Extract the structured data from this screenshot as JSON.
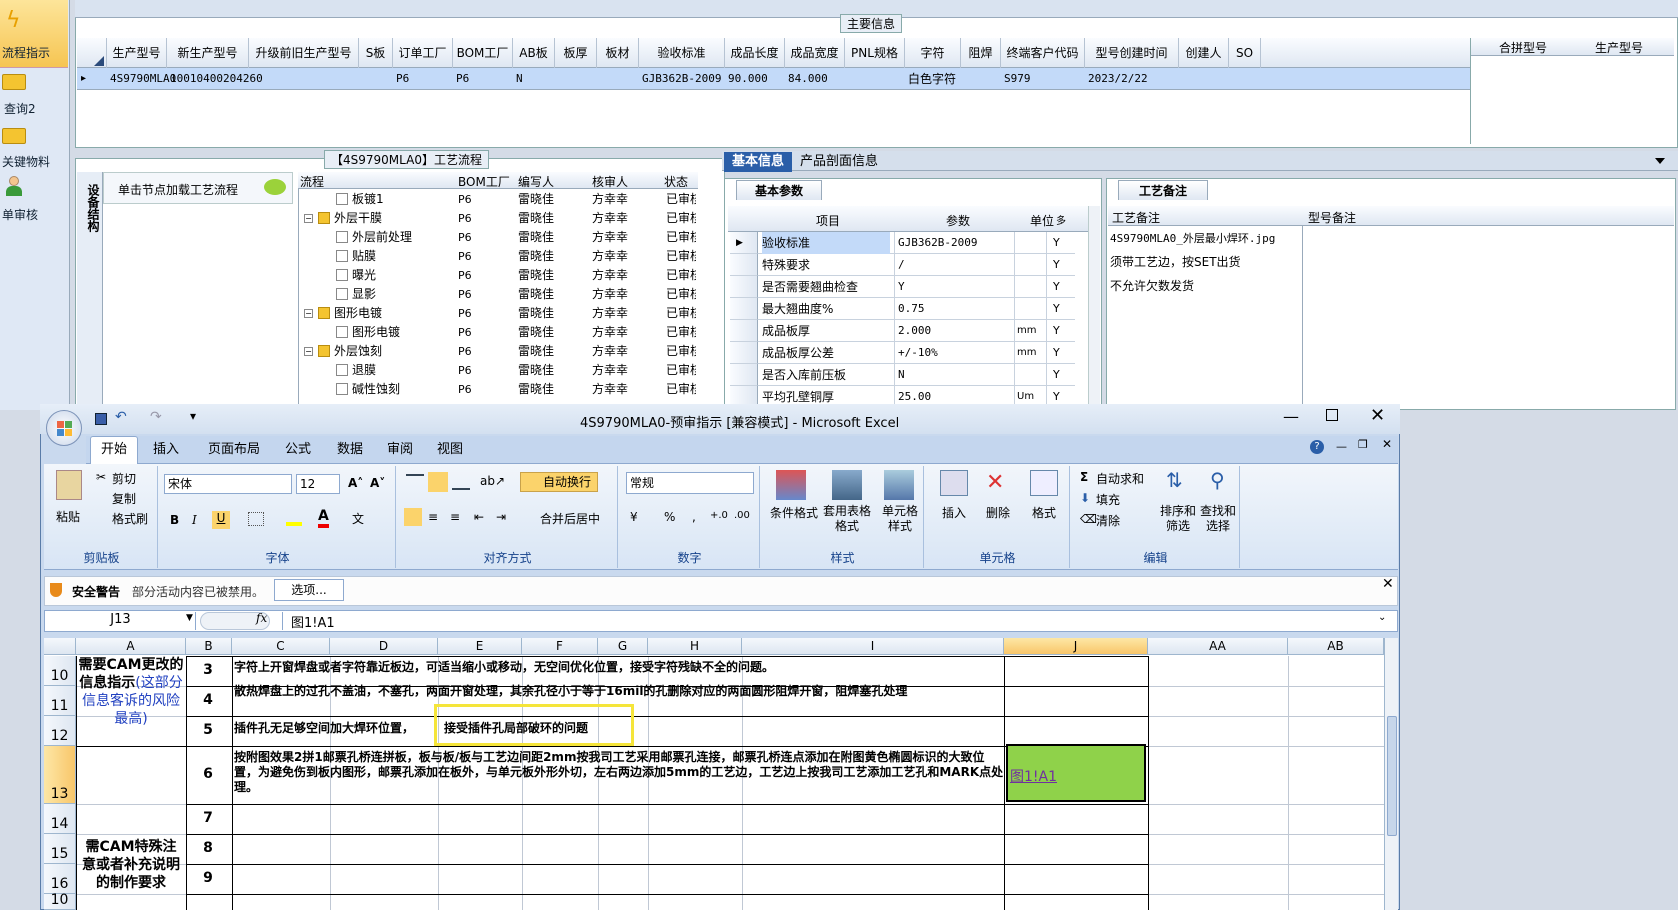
{
  "left_nav": {
    "items": [
      "流程指示",
      "查询2",
      "关键物料",
      "单审核"
    ]
  },
  "top_grid": {
    "legend": "主要信息",
    "columns": [
      "生产型号",
      "新生产型号",
      "升级前旧生产型号",
      "S板",
      "订单工厂",
      "BOM工厂",
      "AB板",
      "板厚",
      "板材",
      "验收标准",
      "成品长度",
      "成品宽度",
      "PNL规格",
      "字符",
      "阻焊",
      "终端客户代码",
      "型号创建时间",
      "创建人",
      "SO"
    ],
    "row": {
      "marker": "▸",
      "生产型号": "4S9790MLA0",
      "新生产型号": "10010400204260",
      "订单工厂": "P6",
      "BOM工厂": "P6",
      "AB板": "N",
      "验收标准": "GJB362B-2009",
      "成品长度": "90.000",
      "成品宽度": "84.000",
      "字符": "白色字符",
      "终端客户代码": "S979",
      "型号创建时间": "2023/2/22"
    },
    "right_columns": [
      "合拼型号",
      "生产型号"
    ]
  },
  "process_panel": {
    "title": "【4S9790MLA0】工艺流程",
    "side_tab": "设备结构",
    "hint": "单击节点加载工艺流程",
    "columns": [
      "流程",
      "BOM工厂",
      "编写人",
      "核审人",
      "状态"
    ],
    "rows": [
      {
        "name": "板镀1",
        "indent": 2,
        "folder": false,
        "bom": "P6",
        "writer": "雷晓佳",
        "reviewer": "方幸幸",
        "status": "已审核"
      },
      {
        "name": "外层干膜",
        "indent": 1,
        "folder": true,
        "bom": "P6",
        "writer": "雷晓佳",
        "reviewer": "方幸幸",
        "status": "已审核"
      },
      {
        "name": "外层前处理",
        "indent": 2,
        "folder": false,
        "bom": "P6",
        "writer": "雷晓佳",
        "reviewer": "方幸幸",
        "status": "已审核"
      },
      {
        "name": "贴膜",
        "indent": 2,
        "folder": false,
        "bom": "P6",
        "writer": "雷晓佳",
        "reviewer": "方幸幸",
        "status": "已审核"
      },
      {
        "name": "曝光",
        "indent": 2,
        "folder": false,
        "bom": "P6",
        "writer": "雷晓佳",
        "reviewer": "方幸幸",
        "status": "已审核"
      },
      {
        "name": "显影",
        "indent": 2,
        "folder": false,
        "bom": "P6",
        "writer": "雷晓佳",
        "reviewer": "方幸幸",
        "status": "已审核"
      },
      {
        "name": "图形电镀",
        "indent": 1,
        "folder": true,
        "bom": "P6",
        "writer": "雷晓佳",
        "reviewer": "方幸幸",
        "status": "已审核"
      },
      {
        "name": "图形电镀",
        "indent": 2,
        "folder": false,
        "bom": "P6",
        "writer": "雷晓佳",
        "reviewer": "方幸幸",
        "status": "已审核"
      },
      {
        "name": "外层蚀刻",
        "indent": 1,
        "folder": true,
        "bom": "P6",
        "writer": "雷晓佳",
        "reviewer": "方幸幸",
        "status": "已审核"
      },
      {
        "name": "退膜",
        "indent": 2,
        "folder": false,
        "bom": "P6",
        "writer": "雷晓佳",
        "reviewer": "方幸幸",
        "status": "已审核"
      },
      {
        "name": "碱性蚀刻",
        "indent": 2,
        "folder": false,
        "bom": "P6",
        "writer": "雷晓佳",
        "reviewer": "方幸幸",
        "status": "已审核"
      }
    ]
  },
  "info_panel": {
    "tabs": [
      "基本信息",
      "产品剖面信息"
    ],
    "subtab": "基本参数",
    "columns": [
      "项目",
      "参数",
      "单位",
      "多"
    ],
    "rows": [
      {
        "item": "验收标准",
        "param": "GJB362B-2009",
        "unit": "",
        "flag": "Y"
      },
      {
        "item": "特殊要求",
        "param": "/",
        "unit": "",
        "flag": "Y"
      },
      {
        "item": "是否需要翘曲检查",
        "param": "Y",
        "unit": "",
        "flag": "Y"
      },
      {
        "item": "最大翘曲度%",
        "param": "0.75",
        "unit": "",
        "flag": "Y"
      },
      {
        "item": "成品板厚",
        "param": "2.000",
        "unit": "mm",
        "flag": "Y"
      },
      {
        "item": "成品板厚公差",
        "param": "+/-10%",
        "unit": "mm",
        "flag": "Y"
      },
      {
        "item": "是否入库前压板",
        "param": "N",
        "unit": "",
        "flag": "Y"
      },
      {
        "item": "平均孔壁铜厚",
        "param": "25.00",
        "unit": "Um",
        "flag": "Y"
      }
    ]
  },
  "remark_panel": {
    "tab": "工艺备注",
    "col1": "工艺备注",
    "col2": "型号备注",
    "lines": [
      "4S9790MLA0_外层最小焊环.jpg",
      "须带工艺边，按SET出货",
      "不允许欠数发货"
    ]
  },
  "excel": {
    "title": "4S9790MLA0-预审指示  [兼容模式] - Microsoft Excel",
    "tabs": [
      "开始",
      "插入",
      "页面布局",
      "公式",
      "数据",
      "审阅",
      "视图"
    ],
    "clipboard": {
      "paste": "粘贴",
      "cut": "剪切",
      "copy": "复制",
      "painter": "格式刷",
      "label": "剪贴板"
    },
    "font": {
      "name": "宋体",
      "size": "12",
      "label": "字体"
    },
    "align": {
      "wrap": "自动换行",
      "merge": "合并后居中",
      "label": "对齐方式"
    },
    "number": {
      "format": "常规",
      "label": "数字"
    },
    "styles": {
      "cond": "条件格式",
      "table": "套用表格格式",
      "cell": "单元格样式",
      "label": "样式"
    },
    "cells": {
      "insert": "插入",
      "delete": "删除",
      "format": "格式",
      "label": "单元格"
    },
    "editing": {
      "autosum": "自动求和",
      "fill": "填充",
      "clear": "清除",
      "sort": "排序和筛选",
      "find": "查找和选择",
      "label": "编辑"
    },
    "security": {
      "title": "安全警告",
      "text": "部分活动内容已被禁用。",
      "button": "选项..."
    },
    "namebox": "J13",
    "formula": "图1!A1",
    "columns": [
      "A",
      "B",
      "C",
      "D",
      "E",
      "F",
      "G",
      "H",
      "I",
      "J",
      "AA",
      "AB"
    ],
    "rows": [
      "10",
      "11",
      "12",
      "13",
      "14",
      "15",
      "16",
      "10"
    ],
    "sectionA1": "需要CAM更改的信息指示",
    "sectionA1_blue": "(这部分信息客诉的风险最高)",
    "sectionA2": "需CAM特殊注意或者补充说明的制作要求",
    "b": [
      "3",
      "4",
      "5",
      "6",
      "7",
      "8",
      "9"
    ],
    "c": [
      "字符上开窗焊盘或者字符靠近板边，可适当缩小或移动，无空间优化位置，接受字符残缺不全的问题。",
      "散热焊盘上的过孔不盖油，不塞孔，两面开窗处理，其余孔径小于等于16mil的孔删除对应的两面圆形阻焊开窗，阻焊塞孔处理",
      "插件孔无足够空间加大焊环位置，",
      "接受插件孔局部破环的问题",
      "按附图效果2拼1邮票孔桥连拼板，板与板/板与工艺边间距2mm按我司工艺采用邮票孔连接，邮票孔桥连点添加在附图黄色椭圆标识的大致位置，为避免伤到板内图形，邮票孔添加在板外，与单元板外形外切，左右两边添加5mm的工艺边，工艺边上按我司工艺添加工艺孔和MARK点处理。"
    ],
    "link": "图1!A1"
  }
}
